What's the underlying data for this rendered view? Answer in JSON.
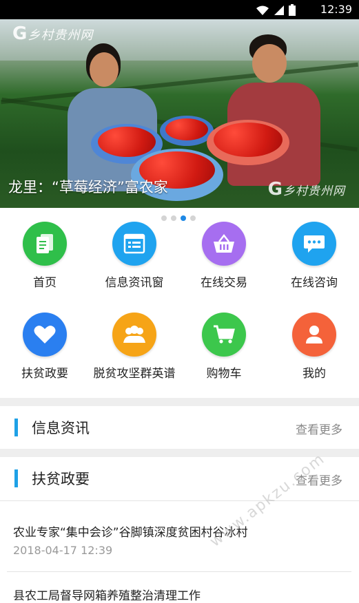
{
  "status_bar": {
    "time": "12:39",
    "icons": [
      "wifi-icon",
      "signal-icon",
      "battery-icon"
    ]
  },
  "banner": {
    "caption": "龙里：“草莓经济”富农家",
    "logo_text": "乡村贵州网",
    "page_count": 4,
    "active_page": 3
  },
  "grid": {
    "items": [
      {
        "label": "首页",
        "icon": "document-icon",
        "color": "#2fbf4a"
      },
      {
        "label": "信息资讯窗",
        "icon": "news-list-icon",
        "color": "#1fa3ef"
      },
      {
        "label": "在线交易",
        "icon": "basket-icon",
        "color": "#a66ef0"
      },
      {
        "label": "在线咨询",
        "icon": "chat-bubble-icon",
        "color": "#1fa3ef"
      },
      {
        "label": "扶贫政要",
        "icon": "heart-icon",
        "color": "#2a7ff0"
      },
      {
        "label": "脱贫攻坚群英谱",
        "icon": "group-icon",
        "color": "#f6a417"
      },
      {
        "label": "购物车",
        "icon": "shopping-cart-icon",
        "color": "#3cc74c"
      },
      {
        "label": "我的",
        "icon": "user-icon",
        "color": "#f4623a"
      }
    ]
  },
  "sections": {
    "info": {
      "title": "信息资讯",
      "more": "查看更多"
    },
    "policy": {
      "title": "扶贫政要",
      "more": "查看更多"
    }
  },
  "news": [
    {
      "title": "农业专家“集中会诊”谷脚镇深度贫困村谷冰村",
      "time": "2018-04-17 12:39"
    },
    {
      "title": "县农工局督导网箱养殖整治清理工作",
      "time": ""
    }
  ],
  "watermark": "www.apkzu.com",
  "colors": {
    "accent": "#1ea1e6",
    "active_dot": "#1e88e5"
  }
}
